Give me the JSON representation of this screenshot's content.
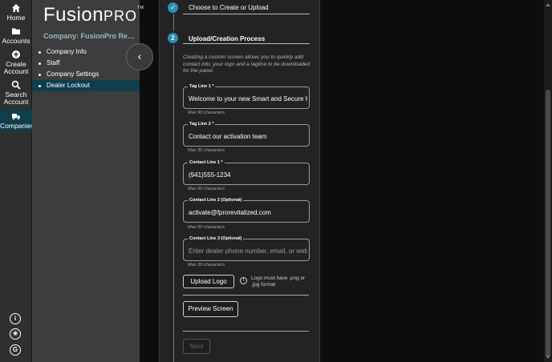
{
  "rail": {
    "items": [
      {
        "label": "Home",
        "icon": "home-icon"
      },
      {
        "label": "Accounts",
        "icon": "folder-icon"
      },
      {
        "label": "Create Account",
        "icon": "plus-circle-icon"
      },
      {
        "label": "Search Account",
        "icon": "search-icon"
      },
      {
        "label": "Companies",
        "icon": "truck-icon"
      }
    ],
    "bottom": [
      {
        "glyph": "i",
        "icon": "info-icon"
      },
      {
        "glyph": "◉",
        "icon": "megaphone-icon"
      },
      {
        "glyph": "G",
        "icon": "g-logo-icon"
      }
    ]
  },
  "sidebar": {
    "brand": "Fusion",
    "brand_suffix": "PRO",
    "brand_tm": "TM",
    "company": "Company: FusionPro Revitalized",
    "items": [
      {
        "label": "Company Info"
      },
      {
        "label": "Staff"
      },
      {
        "label": "Company Settings"
      },
      {
        "label": "Dealer Lockout"
      }
    ],
    "collapse_glyph": "‹"
  },
  "steps": {
    "step1": {
      "title": "Choose to Create or Upload",
      "glyph": "✓"
    },
    "step2": {
      "title": "Upload/Creation Process",
      "number": "2"
    }
  },
  "form": {
    "description": "Creating a custom screen allows you to quickly add contact info, your logo and a tagline to be downloaded for the panel.",
    "fields": [
      {
        "label": "Tag Line 1 *",
        "value": "Welcome to your new Smart and Secure Home",
        "placeholder": "",
        "hint": "Max 90 characters"
      },
      {
        "label": "Tag Line 2 *",
        "value": "Contact our activation team",
        "placeholder": "",
        "hint": "Max 30 characters"
      },
      {
        "label": "Contact Line 1 *",
        "value": "(941)555-1234",
        "placeholder": "",
        "hint": "Max 60 characters"
      },
      {
        "label": "Contact Line 2 (Optional)",
        "value": "activate@fprorevitalized.com",
        "placeholder": "",
        "hint": "Max 60 characters"
      },
      {
        "label": "Contact Line 3 (Optional)",
        "value": "",
        "placeholder": "Enter dealer phone number, email, or website",
        "hint": "Max 35 characters"
      }
    ],
    "upload_label": "Upload Logo",
    "logo_note": "Logo must have .png or .jpg format",
    "preview_label": "Preview Screen",
    "next_label": "Next"
  }
}
